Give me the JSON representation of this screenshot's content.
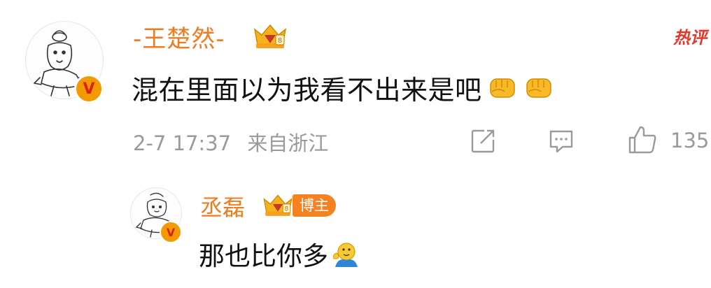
{
  "comment": {
    "username": "-王楚然-",
    "hot_label": "热评",
    "text": "混在里面以为我看不出来是吧",
    "emojis": [
      "fist-emoji",
      "fist-emoji"
    ],
    "time": "2-7 17:37",
    "location": "来自浙江",
    "like_count": "135",
    "verified_icon": "v-icon",
    "actions": [
      "share-icon",
      "reply-icon",
      "like-icon"
    ]
  },
  "reply": {
    "username": "丞磊",
    "badge": "博主",
    "text": "那也比你多",
    "emoji": "wave-emoji",
    "verified_icon": "v-icon"
  },
  "colors": {
    "username": "#f07b1e",
    "meta": "#9a9a9a",
    "badge_bg": "#f58220",
    "hot": "#e6362b",
    "verified": "#f29a00"
  }
}
